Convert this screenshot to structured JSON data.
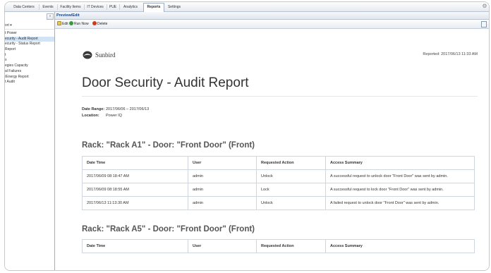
{
  "tabs": [
    {
      "label": "Data Centers",
      "active": false
    },
    {
      "label": "Events",
      "active": false
    },
    {
      "label": "Facility Items",
      "active": false
    },
    {
      "label": "IT Devices",
      "active": false
    },
    {
      "label": "PUE",
      "active": false
    },
    {
      "label": "Analytics",
      "active": false
    },
    {
      "label": "Reports",
      "active": true
    },
    {
      "label": "Settings",
      "active": false
    }
  ],
  "left_panel": {
    "collapse_label": "«",
    "report_dropdown": "ort ▾",
    "items": [
      {
        "label": "t Power",
        "selected": false
      },
      {
        "label": "ecurity - Audit Report",
        "selected": true
      },
      {
        "label": "ecurity - Status Report",
        "selected": false
      },
      {
        "label": "Report",
        "selected": false
      },
      {
        "label": "t",
        "selected": false
      },
      {
        "label": "s",
        "selected": false
      },
      {
        "label": "egies Capacity",
        "selected": false
      },
      {
        "label": "al Failures",
        "selected": false
      },
      {
        "label": "/Energy Report",
        "selected": false
      },
      {
        "label": "t Audit",
        "selected": false
      }
    ]
  },
  "panel": {
    "title": "Preview/Edit",
    "toolbar": {
      "edit": "Edit",
      "run_now": "Run Now",
      "delete": "Delete"
    }
  },
  "report": {
    "logo_text": "Sunbird",
    "reported": "Reported: 2017/06/13 11:33 AM",
    "title": "Door Security - Audit Report",
    "date_range_label": "Date Range:",
    "date_range_value": "2017/06/06 – 2017/06/13",
    "location_label": "Location:",
    "location_value": "Power IQ",
    "columns": [
      "Date Time",
      "User",
      "Requested Action",
      "Access Summary"
    ],
    "sections": [
      {
        "heading": "Rack: \"Rack A1\" - Door: \"Front Door\" (Front)",
        "rows": [
          [
            "2017/06/09 08:18:47 AM",
            "admin",
            "Unlock",
            "A successful request to unlock door \"Front Door\" was sent by admin."
          ],
          [
            "2017/06/09 08:18:55 AM",
            "admin",
            "Lock",
            "A successful request to lock door \"Front Door\" was sent by admin."
          ],
          [
            "2017/06/13 11:13:30 AM",
            "admin",
            "Unlock",
            "A failed request to unlock door \"Front Door\" was sent by admin."
          ]
        ]
      },
      {
        "heading": "Rack: \"Rack A5\" - Door: \"Front Door\" (Front)",
        "rows": []
      }
    ]
  },
  "colors": {
    "accent": "#15428b",
    "selected": "#d3e3f6",
    "run_icon": "#3a9a3a",
    "delete_icon": "#d23a1e"
  }
}
